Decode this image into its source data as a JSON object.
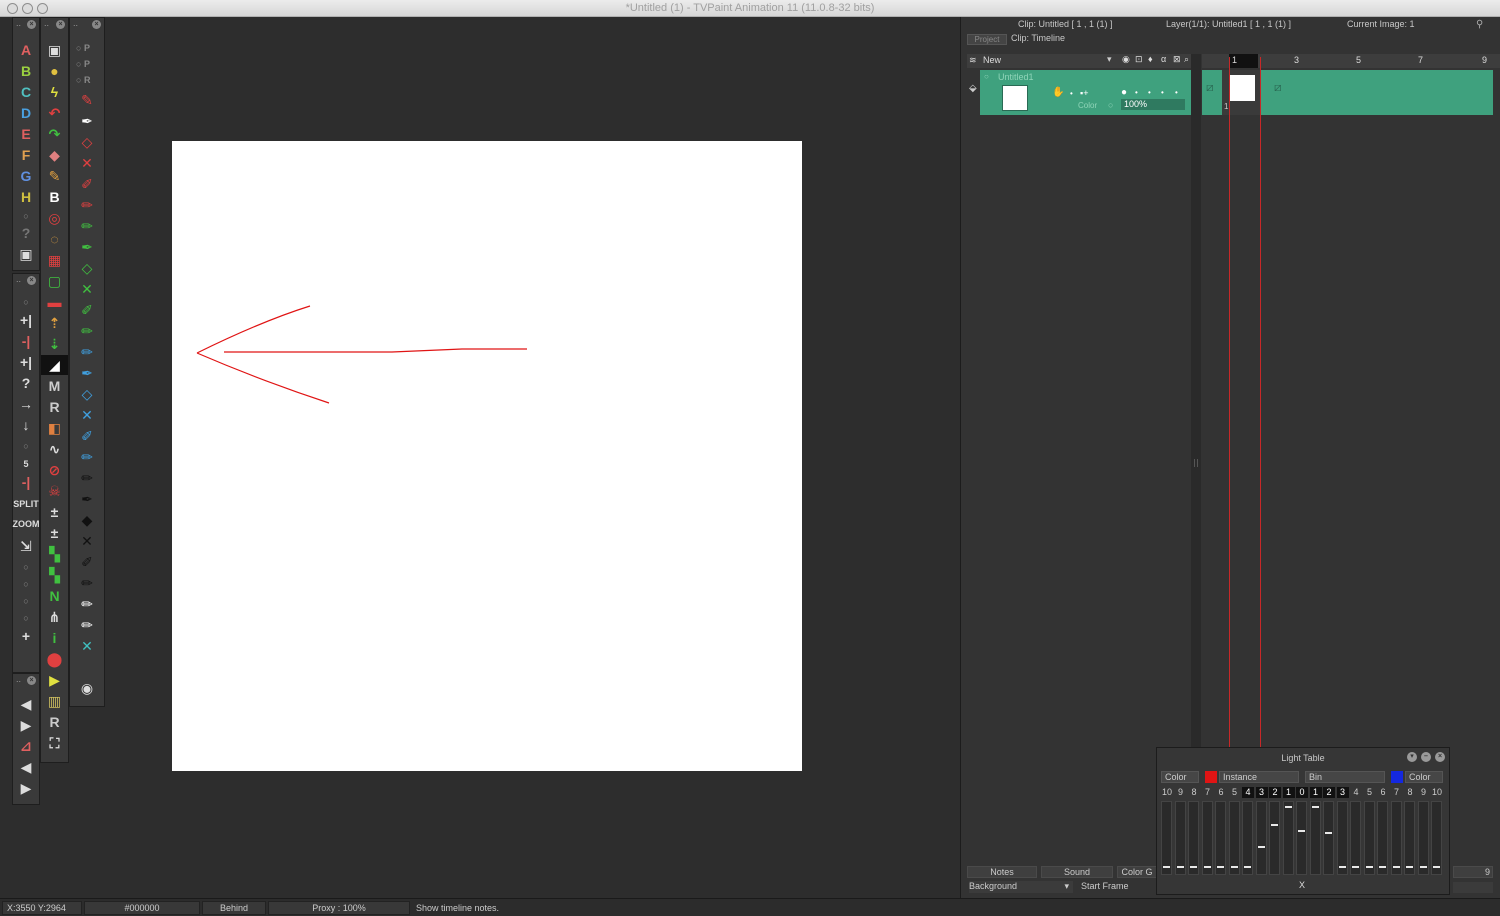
{
  "window": {
    "title": "*Untitled (1) - TVPaint Animation 11 (11.0.8-32 bits)"
  },
  "panel_info": {
    "clip": "Clip: Untitled [ 1 , 1  (1) ]",
    "layer": "Layer(1/1): Untitled1 [ 1 , 1  (1) ]",
    "current_image": "Current Image: 1"
  },
  "tabs": {
    "project": "Project",
    "clip_timeline": "Clip: Timeline"
  },
  "layers": {
    "new_label": "New",
    "layer_name": "Untitled1",
    "color_label": "Color",
    "opacity": "100%"
  },
  "timeline": {
    "frame_numbers": [
      "1",
      "3",
      "5",
      "7",
      "9"
    ],
    "frame_label": "1.",
    "right_number": "9"
  },
  "bottom_buttons": {
    "notes": "Notes",
    "sound": "Sound",
    "color_groups": "Color G"
  },
  "bottom_row": {
    "background": "Background",
    "start_frame": "Start Frame"
  },
  "light_table": {
    "title": "Light Table",
    "left_mode": "Color",
    "instance": "Instance",
    "bin": "Bin",
    "right_mode": "Color",
    "left_color": "#e01414",
    "right_color": "#1428e0",
    "numbers": [
      "10",
      "9",
      "8",
      "7",
      "6",
      "5",
      "4",
      "3",
      "2",
      "1",
      "0",
      "1",
      "2",
      "3",
      "4",
      "5",
      "6",
      "7",
      "8",
      "9",
      "10"
    ],
    "x_label": "X"
  },
  "status": {
    "coords": "X:3550  Y:2964",
    "color": "#000000",
    "mode": "Behind",
    "proxy": "Proxy : 100%",
    "hint": "Show timeline notes."
  },
  "colors": {
    "layer_green": "#3fa17e",
    "stroke_red": "#e01414"
  },
  "toolbars": {
    "col1": [
      "A",
      "B",
      "C",
      "D",
      "E",
      "F",
      "G",
      "H"
    ],
    "col3_radio": [
      "P",
      "P",
      "R"
    ]
  }
}
